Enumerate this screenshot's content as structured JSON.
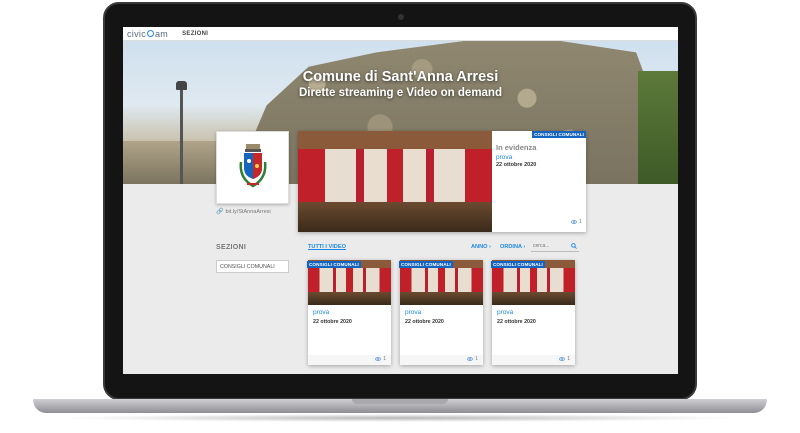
{
  "nav": {
    "logo_pre": "civic",
    "logo_post": "am",
    "sections_label": "SEZIONI"
  },
  "hero": {
    "title": "Comune di Sant'Anna Arresi",
    "subtitle": "Dirette streaming e Video on demand"
  },
  "profile": {
    "link": "bit.ly/StAnnaArresi"
  },
  "featured": {
    "badge": "CONSIGLI COMUNALI",
    "heading": "In evidenza",
    "title": "prova",
    "date": "22 ottobre 2020",
    "views": "1"
  },
  "sidebar": {
    "title": "SEZIONI",
    "select_value": "CONSIGLI COMUNALI"
  },
  "toolbar": {
    "all_videos": "TUTTI I VIDEO",
    "year": "ANNO",
    "sort": "ORDINA",
    "search_placeholder": "cerca..."
  },
  "cards": [
    {
      "badge": "CONSIGLI COMUNALI",
      "title": "prova",
      "date": "22 ottobre 2020",
      "views": "1"
    },
    {
      "badge": "CONSIGLI COMUNALI",
      "title": "prova",
      "date": "22 ottobre 2020",
      "views": "1"
    },
    {
      "badge": "CONSIGLI COMUNALI",
      "title": "prova",
      "date": "22 ottobre 2020",
      "views": "1"
    }
  ],
  "colors": {
    "accent": "#1e88e5",
    "badge": "#1565c0",
    "curtain": "#c0202a"
  },
  "icons": [
    "link-icon",
    "chevron-right-icon",
    "search-icon",
    "eye-icon",
    "camera-icon"
  ]
}
